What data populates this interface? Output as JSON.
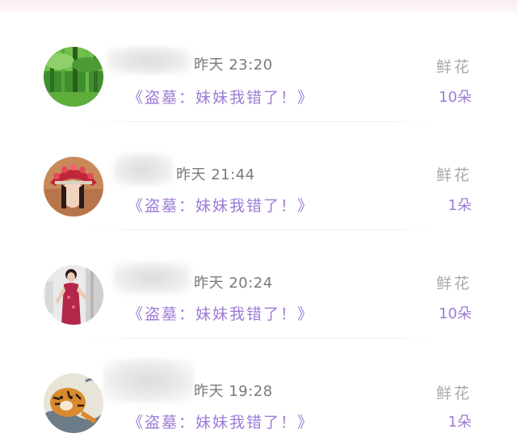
{
  "rows": [
    {
      "time": "昨天 23:20",
      "title": "《盗墓：妹妹我错了！》",
      "gift_label": "鲜花",
      "gift_count": "10朵",
      "avatar_icon": "bamboo-forest-avatar-icon"
    },
    {
      "time": "昨天 21:44",
      "title": "《盗墓：妹妹我错了！》",
      "gift_label": "鲜花",
      "gift_count": "1朵",
      "avatar_icon": "opera-headdress-avatar-icon"
    },
    {
      "time": "昨天 20:24",
      "title": "《盗墓：妹妹我错了！》",
      "gift_label": "鲜花",
      "gift_count": "10朵",
      "avatar_icon": "qipao-woman-avatar-icon"
    },
    {
      "time": "昨天 19:28",
      "title": "《盗墓：妹妹我错了！》",
      "gift_label": "鲜花",
      "gift_count": "1朵",
      "avatar_icon": "tiger-painting-avatar-icon"
    }
  ],
  "colors": {
    "accent": "#9d7bd6",
    "muted": "#a9a9a9",
    "time": "#7a7a7a"
  }
}
